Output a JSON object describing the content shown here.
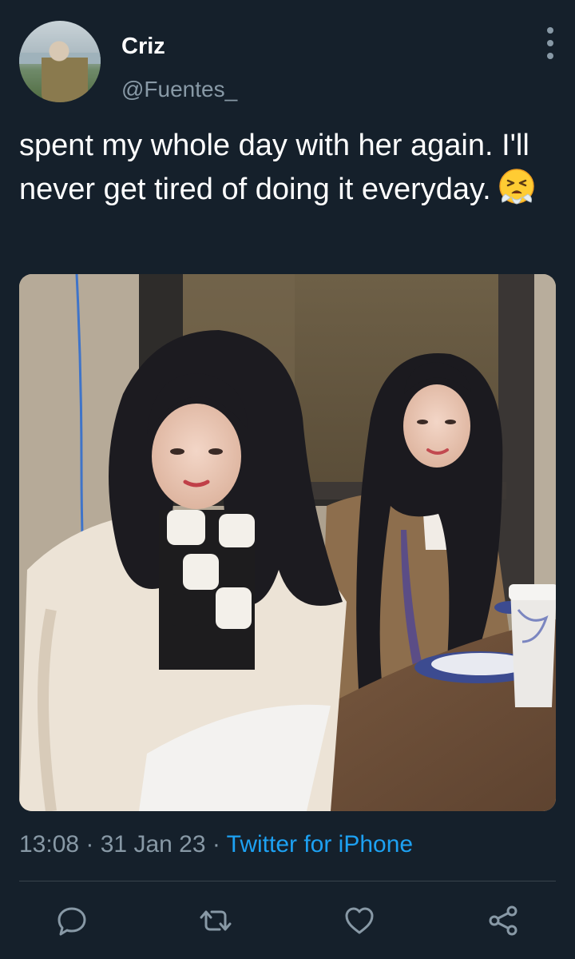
{
  "author": {
    "name": "Criz",
    "handle": "@Fuentes_"
  },
  "tweet": {
    "text": "spent my whole day with her again. I'll never get tired of doing it everyday.",
    "emoji_icon": "face-exhaling-steam-icon"
  },
  "media": {
    "type": "photo"
  },
  "meta": {
    "time": "13:08",
    "separator1": " · ",
    "date": "31 Jan 23",
    "separator2": " · ",
    "source": "Twitter for iPhone"
  },
  "actions": {
    "icons": [
      "reply-icon",
      "retweet-icon",
      "like-icon",
      "share-icon"
    ]
  },
  "colors": {
    "background": "#15202b",
    "secondary_text": "#8899a6",
    "link": "#1da1f2",
    "divider": "#38444d"
  }
}
